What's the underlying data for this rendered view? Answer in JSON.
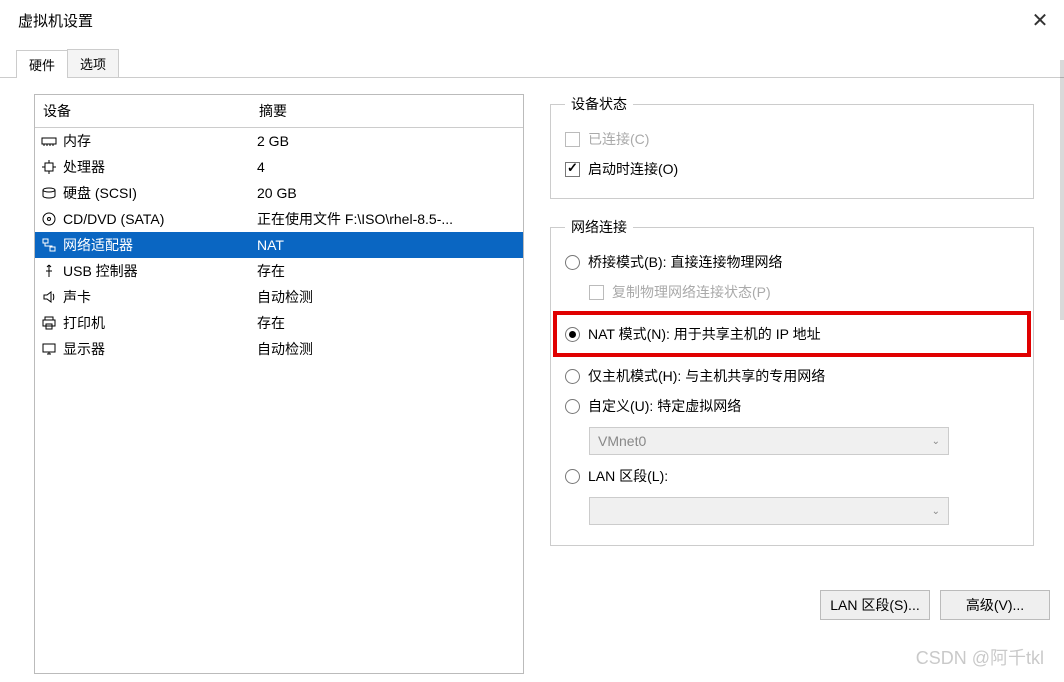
{
  "window": {
    "title": "虚拟机设置"
  },
  "tabs": {
    "hardware": "硬件",
    "options": "选项"
  },
  "device_list": {
    "header_device": "设备",
    "header_summary": "摘要",
    "rows": [
      {
        "name": "内存",
        "summary": "2 GB",
        "icon": "memory"
      },
      {
        "name": "处理器",
        "summary": "4",
        "icon": "cpu"
      },
      {
        "name": "硬盘 (SCSI)",
        "summary": "20 GB",
        "icon": "disk"
      },
      {
        "name": "CD/DVD (SATA)",
        "summary": "正在使用文件 F:\\ISO\\rhel-8.5-...",
        "icon": "cd"
      },
      {
        "name": "网络适配器",
        "summary": "NAT",
        "icon": "net",
        "selected": true
      },
      {
        "name": "USB 控制器",
        "summary": "存在",
        "icon": "usb"
      },
      {
        "name": "声卡",
        "summary": "自动检测",
        "icon": "sound"
      },
      {
        "name": "打印机",
        "summary": "存在",
        "icon": "printer"
      },
      {
        "name": "显示器",
        "summary": "自动检测",
        "icon": "display"
      }
    ]
  },
  "device_state": {
    "legend": "设备状态",
    "connected": "已连接(C)",
    "connect_at_power_on": "启动时连接(O)"
  },
  "network": {
    "legend": "网络连接",
    "bridged": "桥接模式(B): 直接连接物理网络",
    "replicate": "复制物理网络连接状态(P)",
    "nat": "NAT 模式(N): 用于共享主机的 IP 地址",
    "hostonly": "仅主机模式(H): 与主机共享的专用网络",
    "custom": "自定义(U): 特定虚拟网络",
    "vmnet": "VMnet0",
    "lanseg": "LAN 区段(L):"
  },
  "buttons": {
    "lan_segments": "LAN 区段(S)...",
    "advanced": "高级(V)..."
  },
  "watermark": "CSDN @阿千tkl"
}
